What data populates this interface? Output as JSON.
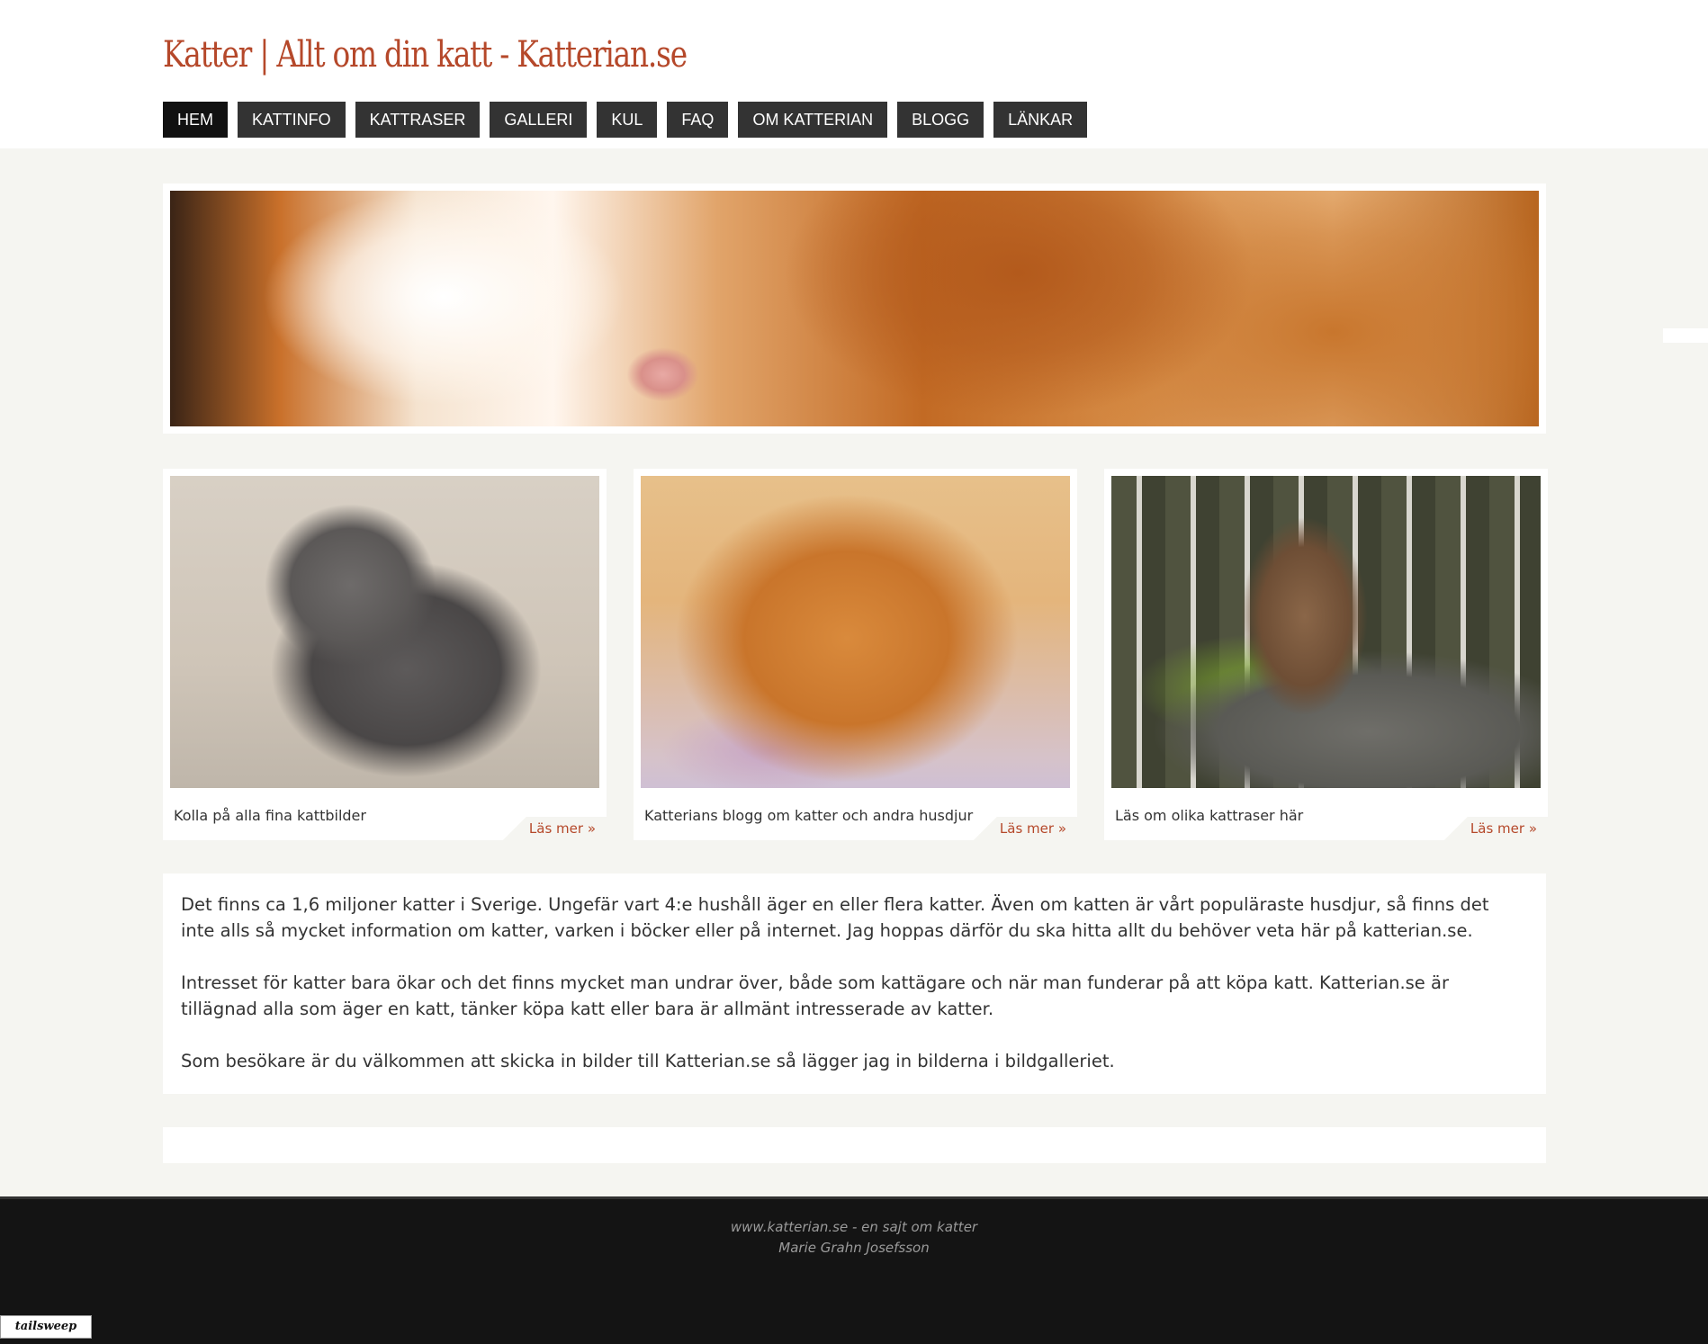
{
  "header": {
    "site_title": "Katter | Allt om din katt - Katterian.se"
  },
  "nav": {
    "items": [
      {
        "label": "HEM",
        "active": true
      },
      {
        "label": "KATTINFO"
      },
      {
        "label": "KATTRASER"
      },
      {
        "label": "GALLERI"
      },
      {
        "label": "KUL"
      },
      {
        "label": "FAQ"
      },
      {
        "label": "OM KATTERIAN"
      },
      {
        "label": "BLOGG"
      },
      {
        "label": "LÄNKAR"
      }
    ]
  },
  "cards": [
    {
      "caption": "Kolla på alla fina kattbilder",
      "link": "Läs mer »",
      "image": "grey-tabby-cat-photo"
    },
    {
      "caption": "Katterians blogg om katter och andra husdjur",
      "link": "Läs mer »",
      "image": "orange-cat-upside-down-photo"
    },
    {
      "caption": "Läs om olika kattraser här",
      "link": "Läs mer »",
      "image": "bengal-cat-forest-photo"
    }
  ],
  "content": {
    "paragraphs": [
      "Det finns ca 1,6 miljoner katter i Sverige. Ungefär vart 4:e hushåll äger en eller flera katter. Även om katten är vårt populäraste husdjur, så finns det inte alls så mycket information om katter, varken i böcker eller på internet. Jag hoppas därför du ska hitta allt du behöver veta här på katterian.se.",
      "Intresset för katter bara ökar och det finns mycket man undrar över, både som kattägare och när man funderar på att köpa katt. Katterian.se är tillägnad alla som äger en katt, tänker köpa katt eller bara är allmänt intresserade av katter.",
      "Som besökare är du välkommen att skicka in bilder till Katterian.se så lägger jag in bilderna i bildgalleriet."
    ]
  },
  "footer": {
    "line1": "www.katterian.se - en sajt om katter",
    "line2": "Marie Grahn Josefsson"
  },
  "badge": {
    "label": "tailsweep"
  },
  "colors": {
    "accent": "#b5482a",
    "nav_bg": "#333333",
    "nav_active_bg": "#111111",
    "page_bg": "#f5f5f1",
    "footer_bg": "#141414"
  }
}
